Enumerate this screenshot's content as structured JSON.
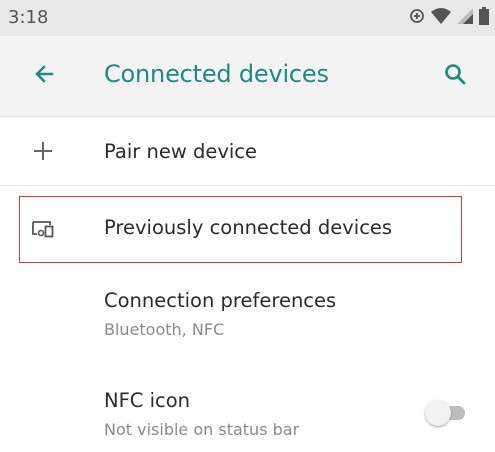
{
  "status_bar": {
    "time": "3:18",
    "icons": [
      "data-saver-icon",
      "wifi-icon",
      "signal-icon",
      "battery-icon"
    ]
  },
  "app_bar": {
    "title": "Connected devices",
    "back_icon": "arrow-back-icon",
    "search_icon": "search-icon"
  },
  "colors": {
    "accent": "#1e8a80",
    "highlight_border": "#e0353b"
  },
  "items": [
    {
      "title": "Pair new device",
      "icon": "plus-icon"
    },
    {
      "title": "Previously connected devices",
      "icon": "devices-icon"
    },
    {
      "title": "Connection preferences",
      "subtitle": "Bluetooth, NFC"
    },
    {
      "title": "NFC icon",
      "subtitle": "Not visible on status bar",
      "toggle_on": false
    }
  ]
}
